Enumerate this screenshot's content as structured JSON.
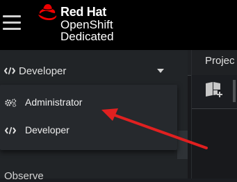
{
  "masthead": {
    "brand_company": "Red Hat",
    "brand_product": "OpenShift",
    "brand_tier": "Dedicated",
    "logo_icon": "redhat-logo-icon",
    "menu_icon": "hamburger-menu-icon",
    "bg_color": "#000000",
    "logo_color": "#ee0000"
  },
  "perspective": {
    "current_label": "Developer",
    "current_icon": "code-icon",
    "caret_icon": "caret-down-icon"
  },
  "dropdown": {
    "items": [
      {
        "label": "Administrator",
        "icon": "cogs-icon"
      },
      {
        "label": "Developer",
        "icon": "code-icon"
      }
    ]
  },
  "sidebar": {
    "observe_label": "Observe"
  },
  "main": {
    "tab_label": "Projec",
    "toolbar_icon": "catalog-add-icon"
  },
  "annotation": {
    "arrow_color": "#e02020",
    "arrow_icon": "red-arrow"
  }
}
